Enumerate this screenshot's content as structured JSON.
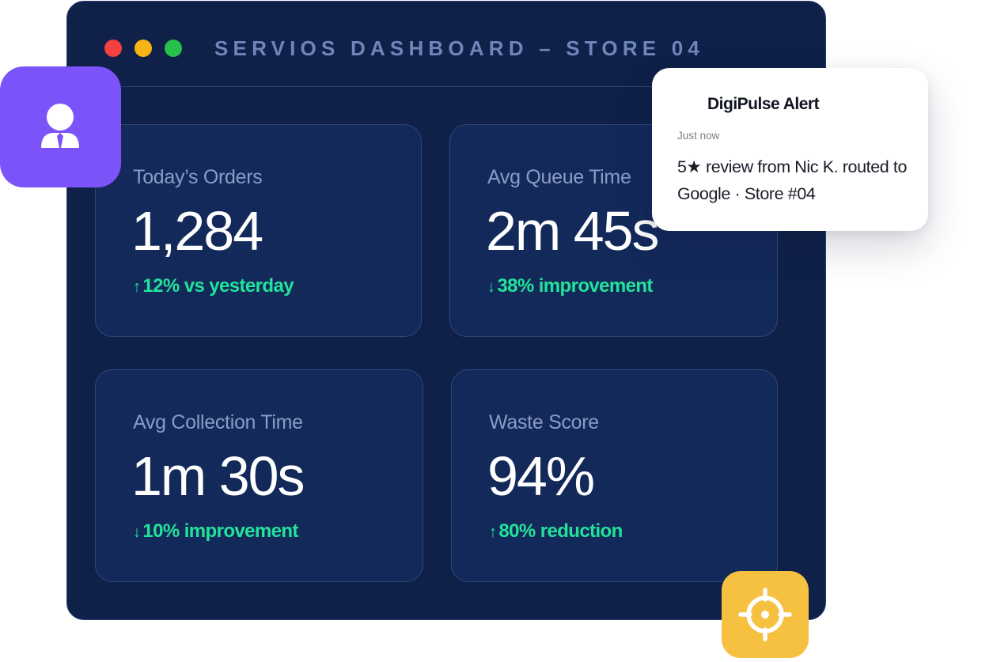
{
  "window": {
    "title": "SERVIOS DASHBOARD – STORE 04",
    "traffic_lights": [
      "#f2413f",
      "#f7b415",
      "#27c04a"
    ]
  },
  "metrics": [
    {
      "label": "Today’s Orders",
      "value": "1,284",
      "arrow": "↑",
      "delta": "12% vs yesterday"
    },
    {
      "label": "Avg Queue Time",
      "value": "2m 45s",
      "arrow": "↓",
      "delta": "38% improvement"
    },
    {
      "label": "Avg Collection Time",
      "value": "1m 30s",
      "arrow": "↓",
      "delta": "10% improvement"
    },
    {
      "label": "Waste Score",
      "value": "94%",
      "arrow": "↑",
      "delta": "80% reduction"
    }
  ],
  "alert": {
    "title": "DigiPulse Alert",
    "time": "Just now",
    "message": "5★ review from Nic K. routed to Google · Store #04"
  },
  "icons": {
    "user_badge": "user-icon",
    "target_badge": "crosshair-icon"
  },
  "colors": {
    "window_bg": "#0f2149",
    "card_bg": "#13295a",
    "positive": "#22e39a",
    "purple_badge": "#7b53f9",
    "yellow_badge": "#f6c041"
  }
}
